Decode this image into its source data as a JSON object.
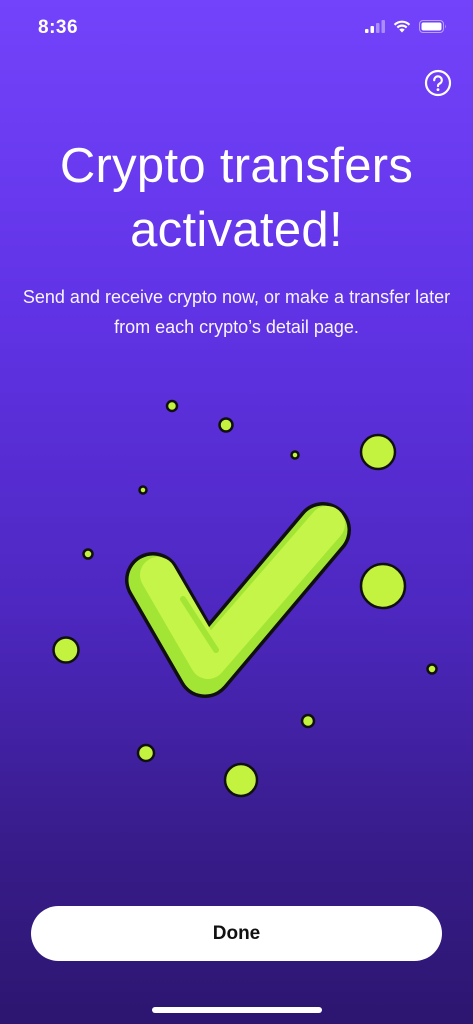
{
  "status_bar": {
    "time": "8:36"
  },
  "header": {
    "help_icon": "question-circle-icon"
  },
  "main": {
    "title": "Crypto transfers activated!",
    "subtitle": "Send and receive crypto now, or make a transfer later from each crypto’s detail page.",
    "illustration": "checkmark-with-bubbles",
    "colors": {
      "background_top": "#7343fb",
      "background_bottom": "#2c1670",
      "accent_green": "#c3f23f",
      "check_green": "#b8f03c"
    }
  },
  "footer": {
    "done_label": "Done"
  }
}
